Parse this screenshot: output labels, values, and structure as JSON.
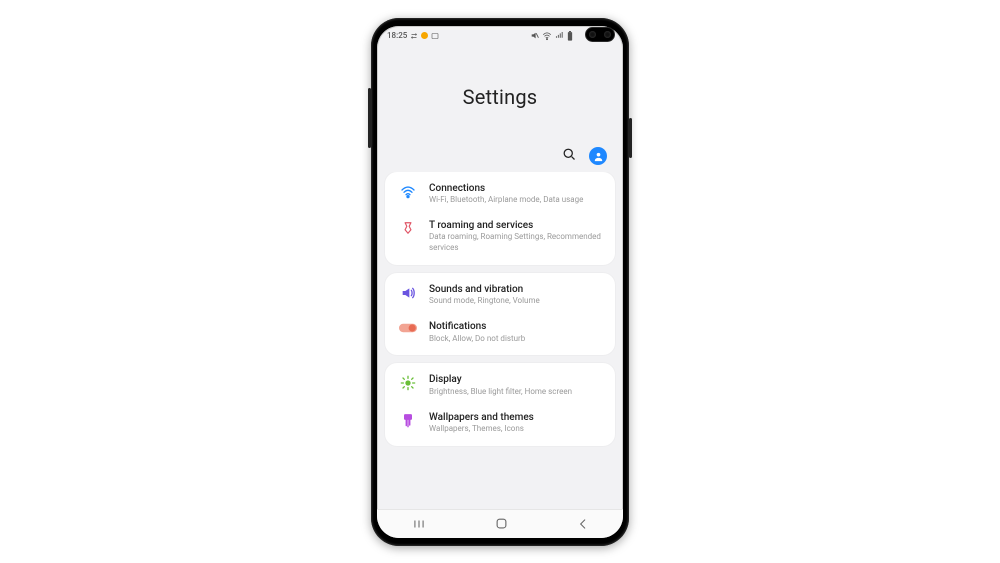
{
  "status": {
    "time": "18:25",
    "icons_right": [
      "mute",
      "wifi",
      "signal",
      "battery"
    ]
  },
  "header": {
    "title": "Settings"
  },
  "groups": [
    {
      "items": [
        {
          "icon": "wifi",
          "title": "Connections",
          "subtitle": "Wi-Fi, Bluetooth, Airplane mode, Data usage"
        },
        {
          "icon": "t",
          "title": "T roaming and services",
          "subtitle": "Data roaming, Roaming Settings, Recommended services"
        }
      ]
    },
    {
      "items": [
        {
          "icon": "sound",
          "title": "Sounds and vibration",
          "subtitle": "Sound mode, Ringtone, Volume"
        },
        {
          "icon": "notif",
          "title": "Notifications",
          "subtitle": "Block, Allow, Do not disturb"
        }
      ]
    },
    {
      "items": [
        {
          "icon": "display",
          "title": "Display",
          "subtitle": "Brightness, Blue light filter, Home screen"
        },
        {
          "icon": "wallpaper",
          "title": "Wallpapers and themes",
          "subtitle": "Wallpapers, Themes, Icons"
        }
      ]
    }
  ],
  "icon_colors": {
    "wifi": "#1e88ff",
    "t": "#e05566",
    "sound": "#6a55e0",
    "notif": "#e86b53",
    "display": "#6bbf3a",
    "wallpaper": "#b74de0"
  }
}
